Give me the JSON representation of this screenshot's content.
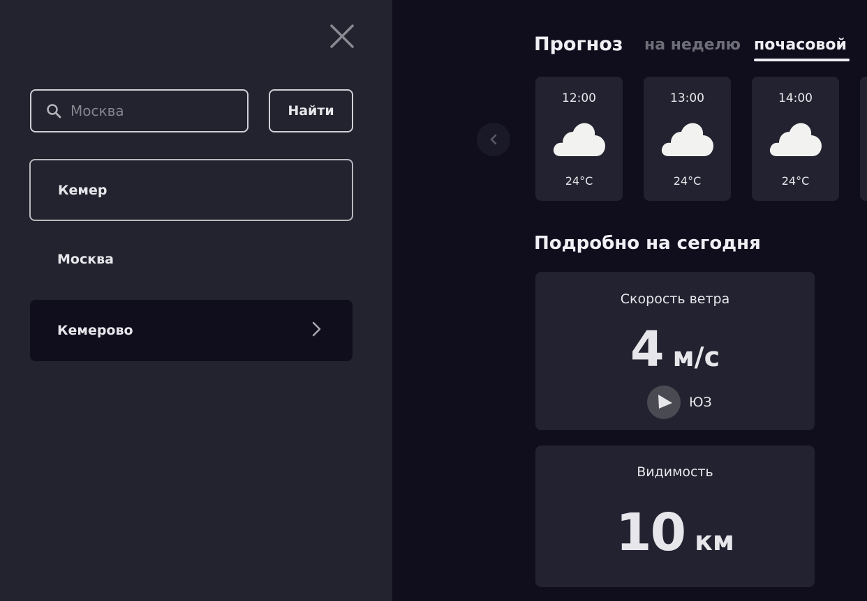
{
  "sidebar": {
    "search": {
      "placeholder": "Москва",
      "value": ""
    },
    "find_label": "Найти",
    "cities": [
      {
        "name": "Кемер"
      },
      {
        "name": "Москва"
      },
      {
        "name": "Кемерово"
      }
    ]
  },
  "forecast": {
    "title": "Прогноз",
    "tabs": [
      {
        "label": "на неделю",
        "active": false
      },
      {
        "label": "почасовой",
        "active": true
      }
    ],
    "hours": [
      {
        "time": "12:00",
        "icon": "cloud-icon",
        "temp": "24°C"
      },
      {
        "time": "13:00",
        "icon": "cloud-icon",
        "temp": "24°C"
      },
      {
        "time": "14:00",
        "icon": "cloud-icon",
        "temp": "24°C"
      }
    ]
  },
  "details": {
    "title": "Подробно на сегодня",
    "wind": {
      "label": "Скорость ветра",
      "value": "4",
      "unit": "м/с",
      "direction": "ЮЗ"
    },
    "visibility": {
      "label": "Видимость",
      "value": "10",
      "unit": "км"
    }
  },
  "colors": {
    "background": "#100e1d",
    "sidebar": "#22232f",
    "card": "#222230",
    "text": "#e7e7eb",
    "muted": "#6e6e78"
  }
}
